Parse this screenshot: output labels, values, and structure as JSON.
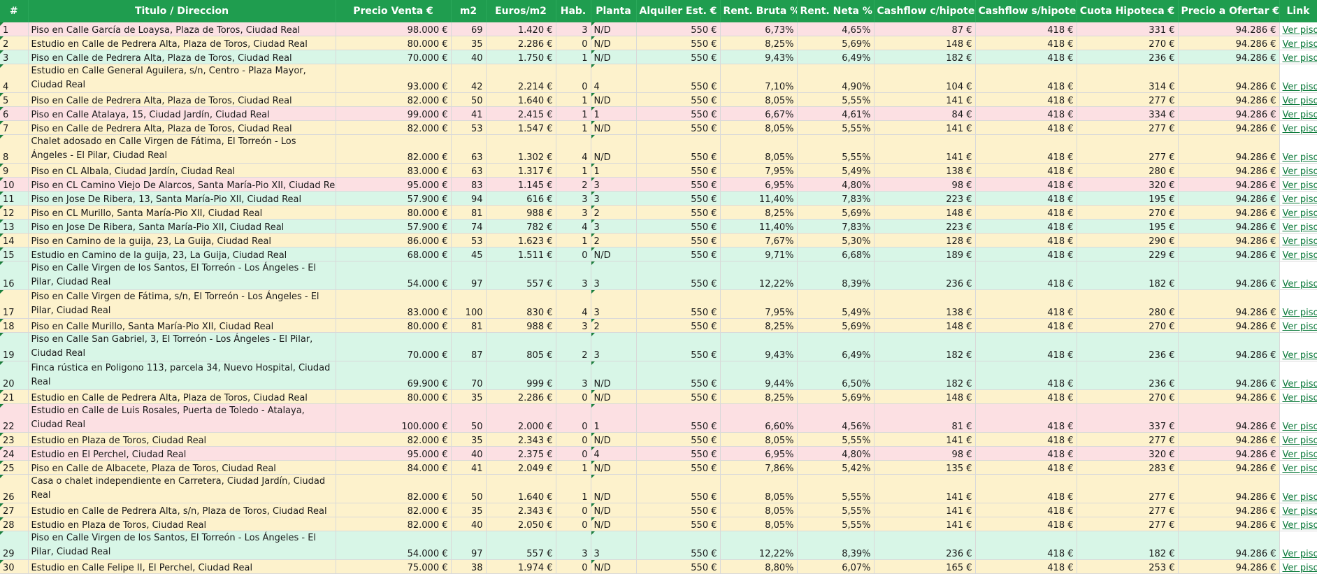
{
  "headers": [
    "#",
    "Titulo / Direccion",
    "Precio Venta €",
    "m2",
    "Euros/m2",
    "Hab.",
    "Planta",
    "Alquiler Est. €",
    "Rent. Bruta %",
    "Rent. Neta %",
    "Cashflow c/hipoteca €",
    "Cashflow s/hipoteca €",
    "Cuota Hipoteca €",
    "Precio a Ofertar €",
    "Link"
  ],
  "colors": {
    "header": "#1f9d4f",
    "pink": "#fce0e3",
    "yellow": "#fdf2cc",
    "green": "#d8f6e7",
    "link": "#0b7a3a"
  },
  "rows": [
    {
      "n": "1",
      "title": "Piso en Calle García de Loaysa, Plaza de Toros, Ciudad Real",
      "price": "98.000 €",
      "m2": "69",
      "eurm2": "1.420 €",
      "hab": "3",
      "planta": "N/D",
      "alq": "550 €",
      "rb": "6,73%",
      "rn": "4,65%",
      "cfc": "87 €",
      "cfs": "418 €",
      "cuota": "331 €",
      "oferta": "94.286 €",
      "link": "Ver piso",
      "color": "pink",
      "h": 1
    },
    {
      "n": "2",
      "title": "Estudio en Calle de Pedrera Alta, Plaza de Toros, Ciudad Real",
      "price": "80.000 €",
      "m2": "35",
      "eurm2": "2.286 €",
      "hab": "0",
      "planta": "N/D",
      "alq": "550 €",
      "rb": "8,25%",
      "rn": "5,69%",
      "cfc": "148 €",
      "cfs": "418 €",
      "cuota": "270 €",
      "oferta": "94.286 €",
      "link": "Ver piso",
      "color": "yellow",
      "h": 1
    },
    {
      "n": "3",
      "title": "Piso en Calle de Pedrera Alta, Plaza de Toros, Ciudad Real",
      "price": "70.000 €",
      "m2": "40",
      "eurm2": "1.750 €",
      "hab": "1",
      "planta": "N/D",
      "alq": "550 €",
      "rb": "9,43%",
      "rn": "6,49%",
      "cfc": "182 €",
      "cfs": "418 €",
      "cuota": "236 €",
      "oferta": "94.286 €",
      "link": "Ver piso",
      "color": "green",
      "h": 1
    },
    {
      "n": "4",
      "title": "Estudio en Calle General Aguilera, s/n, Centro - Plaza Mayor, Ciudad Real",
      "price": "93.000 €",
      "m2": "42",
      "eurm2": "2.214 €",
      "hab": "0",
      "planta": "4",
      "alq": "550 €",
      "rb": "7,10%",
      "rn": "4,90%",
      "cfc": "104 €",
      "cfs": "418 €",
      "cuota": "314 €",
      "oferta": "94.286 €",
      "link": "Ver piso",
      "color": "yellow",
      "h": 2
    },
    {
      "n": "5",
      "title": "Piso en Calle de Pedrera Alta, Plaza de Toros, Ciudad Real",
      "price": "82.000 €",
      "m2": "50",
      "eurm2": "1.640 €",
      "hab": "1",
      "planta": "N/D",
      "alq": "550 €",
      "rb": "8,05%",
      "rn": "5,55%",
      "cfc": "141 €",
      "cfs": "418 €",
      "cuota": "277 €",
      "oferta": "94.286 €",
      "link": "Ver piso",
      "color": "yellow",
      "h": 1
    },
    {
      "n": "6",
      "title": "Piso en Calle Atalaya, 15, Ciudad Jardín, Ciudad Real",
      "price": "99.000 €",
      "m2": "41",
      "eurm2": "2.415 €",
      "hab": "1",
      "planta": "1",
      "alq": "550 €",
      "rb": "6,67%",
      "rn": "4,61%",
      "cfc": "84 €",
      "cfs": "418 €",
      "cuota": "334 €",
      "oferta": "94.286 €",
      "link": "Ver piso",
      "color": "pink",
      "h": 1
    },
    {
      "n": "7",
      "title": "Piso en Calle de Pedrera Alta, Plaza de Toros, Ciudad Real",
      "price": "82.000 €",
      "m2": "53",
      "eurm2": "1.547 €",
      "hab": "1",
      "planta": "N/D",
      "alq": "550 €",
      "rb": "8,05%",
      "rn": "5,55%",
      "cfc": "141 €",
      "cfs": "418 €",
      "cuota": "277 €",
      "oferta": "94.286 €",
      "link": "Ver piso",
      "color": "yellow",
      "h": 1
    },
    {
      "n": "8",
      "title": "Chalet adosado en Calle Virgen de Fátima, El Torreón - Los Ángeles - El Pilar, Ciudad Real",
      "price": "82.000 €",
      "m2": "63",
      "eurm2": "1.302 €",
      "hab": "4",
      "planta": "N/D",
      "alq": "550 €",
      "rb": "8,05%",
      "rn": "5,55%",
      "cfc": "141 €",
      "cfs": "418 €",
      "cuota": "277 €",
      "oferta": "94.286 €",
      "link": "Ver piso",
      "color": "yellow",
      "h": 2
    },
    {
      "n": "9",
      "title": "Piso en CL Albala, Ciudad Jardín, Ciudad Real",
      "price": "83.000 €",
      "m2": "63",
      "eurm2": "1.317 €",
      "hab": "1",
      "planta": "1",
      "alq": "550 €",
      "rb": "7,95%",
      "rn": "5,49%",
      "cfc": "138 €",
      "cfs": "418 €",
      "cuota": "280 €",
      "oferta": "94.286 €",
      "link": "Ver piso",
      "color": "yellow",
      "h": 1
    },
    {
      "n": "10",
      "title": "Piso en CL Camino Viejo De Alarcos, Santa María-Pio XII, Ciudad Real",
      "price": "95.000 €",
      "m2": "83",
      "eurm2": "1.145 €",
      "hab": "2",
      "planta": "3",
      "alq": "550 €",
      "rb": "6,95%",
      "rn": "4,80%",
      "cfc": "98 €",
      "cfs": "418 €",
      "cuota": "320 €",
      "oferta": "94.286 €",
      "link": "Ver piso",
      "color": "pink",
      "h": 1
    },
    {
      "n": "11",
      "title": "Piso en Jose De Ribera, 13, Santa María-Pio XII, Ciudad Real",
      "price": "57.900 €",
      "m2": "94",
      "eurm2": "616 €",
      "hab": "3",
      "planta": "3",
      "alq": "550 €",
      "rb": "11,40%",
      "rn": "7,83%",
      "cfc": "223 €",
      "cfs": "418 €",
      "cuota": "195 €",
      "oferta": "94.286 €",
      "link": "Ver piso",
      "color": "green",
      "h": 1
    },
    {
      "n": "12",
      "title": "Piso en CL Murillo, Santa María-Pio XII, Ciudad Real",
      "price": "80.000 €",
      "m2": "81",
      "eurm2": "988 €",
      "hab": "3",
      "planta": "2",
      "alq": "550 €",
      "rb": "8,25%",
      "rn": "5,69%",
      "cfc": "148 €",
      "cfs": "418 €",
      "cuota": "270 €",
      "oferta": "94.286 €",
      "link": "Ver piso",
      "color": "yellow",
      "h": 1
    },
    {
      "n": "13",
      "title": "Piso en Jose De Ribera, Santa María-Pio XII, Ciudad Real",
      "price": "57.900 €",
      "m2": "74",
      "eurm2": "782 €",
      "hab": "4",
      "planta": "3",
      "alq": "550 €",
      "rb": "11,40%",
      "rn": "7,83%",
      "cfc": "223 €",
      "cfs": "418 €",
      "cuota": "195 €",
      "oferta": "94.286 €",
      "link": "Ver piso",
      "color": "green",
      "h": 1
    },
    {
      "n": "14",
      "title": "Piso en Camino de la guija, 23, La Guija, Ciudad Real",
      "price": "86.000 €",
      "m2": "53",
      "eurm2": "1.623 €",
      "hab": "1",
      "planta": "2",
      "alq": "550 €",
      "rb": "7,67%",
      "rn": "5,30%",
      "cfc": "128 €",
      "cfs": "418 €",
      "cuota": "290 €",
      "oferta": "94.286 €",
      "link": "Ver piso",
      "color": "yellow",
      "h": 1
    },
    {
      "n": "15",
      "title": "Estudio en Camino de la guija, 23, La Guija, Ciudad Real",
      "price": "68.000 €",
      "m2": "45",
      "eurm2": "1.511 €",
      "hab": "0",
      "planta": "N/D",
      "alq": "550 €",
      "rb": "9,71%",
      "rn": "6,68%",
      "cfc": "189 €",
      "cfs": "418 €",
      "cuota": "229 €",
      "oferta": "94.286 €",
      "link": "Ver piso",
      "color": "green",
      "h": 1
    },
    {
      "n": "16",
      "title": "Piso en Calle Virgen de los Santos, El Torreón - Los Ángeles - El Pilar, Ciudad Real",
      "price": "54.000 €",
      "m2": "97",
      "eurm2": "557 €",
      "hab": "3",
      "planta": "3",
      "alq": "550 €",
      "rb": "12,22%",
      "rn": "8,39%",
      "cfc": "236 €",
      "cfs": "418 €",
      "cuota": "182 €",
      "oferta": "94.286 €",
      "link": "Ver piso",
      "color": "green",
      "h": 2
    },
    {
      "n": "17",
      "title": "Piso en Calle Virgen de Fátima, s/n, El Torreón - Los Ángeles - El Pilar, Ciudad Real",
      "price": "83.000 €",
      "m2": "100",
      "eurm2": "830 €",
      "hab": "4",
      "planta": "3",
      "alq": "550 €",
      "rb": "7,95%",
      "rn": "5,49%",
      "cfc": "138 €",
      "cfs": "418 €",
      "cuota": "280 €",
      "oferta": "94.286 €",
      "link": "Ver piso",
      "color": "yellow",
      "h": 2
    },
    {
      "n": "18",
      "title": "Piso en Calle Murillo, Santa María-Pio XII, Ciudad Real",
      "price": "80.000 €",
      "m2": "81",
      "eurm2": "988 €",
      "hab": "3",
      "planta": "2",
      "alq": "550 €",
      "rb": "8,25%",
      "rn": "5,69%",
      "cfc": "148 €",
      "cfs": "418 €",
      "cuota": "270 €",
      "oferta": "94.286 €",
      "link": "Ver piso",
      "color": "yellow",
      "h": 1
    },
    {
      "n": "19",
      "title": "Piso en Calle San Gabriel, 3, El Torreón - Los Ángeles - El Pilar, Ciudad Real",
      "price": "70.000 €",
      "m2": "87",
      "eurm2": "805 €",
      "hab": "2",
      "planta": "3",
      "alq": "550 €",
      "rb": "9,43%",
      "rn": "6,49%",
      "cfc": "182 €",
      "cfs": "418 €",
      "cuota": "236 €",
      "oferta": "94.286 €",
      "link": "Ver piso",
      "color": "green",
      "h": 2
    },
    {
      "n": "20",
      "title": "Finca rústica en Poligono 113, parcela 34, Nuevo Hospital, Ciudad Real",
      "price": "69.900 €",
      "m2": "70",
      "eurm2": "999 €",
      "hab": "3",
      "planta": "N/D",
      "alq": "550 €",
      "rb": "9,44%",
      "rn": "6,50%",
      "cfc": "182 €",
      "cfs": "418 €",
      "cuota": "236 €",
      "oferta": "94.286 €",
      "link": "Ver piso",
      "color": "green",
      "h": 2
    },
    {
      "n": "21",
      "title": "Estudio en Calle de Pedrera Alta, Plaza de Toros, Ciudad Real",
      "price": "80.000 €",
      "m2": "35",
      "eurm2": "2.286 €",
      "hab": "0",
      "planta": "N/D",
      "alq": "550 €",
      "rb": "8,25%",
      "rn": "5,69%",
      "cfc": "148 €",
      "cfs": "418 €",
      "cuota": "270 €",
      "oferta": "94.286 €",
      "link": "Ver piso",
      "color": "yellow",
      "h": 1
    },
    {
      "n": "22",
      "title": "Estudio en Calle de Luis Rosales, Puerta de Toledo - Atalaya, Ciudad Real",
      "price": "100.000 €",
      "m2": "50",
      "eurm2": "2.000 €",
      "hab": "0",
      "planta": "1",
      "alq": "550 €",
      "rb": "6,60%",
      "rn": "4,56%",
      "cfc": "81 €",
      "cfs": "418 €",
      "cuota": "337 €",
      "oferta": "94.286 €",
      "link": "Ver piso",
      "color": "pink",
      "h": 2
    },
    {
      "n": "23",
      "title": "Estudio en Plaza de Toros, Ciudad Real",
      "price": "82.000 €",
      "m2": "35",
      "eurm2": "2.343 €",
      "hab": "0",
      "planta": "N/D",
      "alq": "550 €",
      "rb": "8,05%",
      "rn": "5,55%",
      "cfc": "141 €",
      "cfs": "418 €",
      "cuota": "277 €",
      "oferta": "94.286 €",
      "link": "Ver piso",
      "color": "yellow",
      "h": 1
    },
    {
      "n": "24",
      "title": "Estudio en El Perchel, Ciudad Real",
      "price": "95.000 €",
      "m2": "40",
      "eurm2": "2.375 €",
      "hab": "0",
      "planta": "4",
      "alq": "550 €",
      "rb": "6,95%",
      "rn": "4,80%",
      "cfc": "98 €",
      "cfs": "418 €",
      "cuota": "320 €",
      "oferta": "94.286 €",
      "link": "Ver piso",
      "color": "pink",
      "h": 1
    },
    {
      "n": "25",
      "title": "Piso en Calle de Albacete, Plaza de Toros, Ciudad Real",
      "price": "84.000 €",
      "m2": "41",
      "eurm2": "2.049 €",
      "hab": "1",
      "planta": "N/D",
      "alq": "550 €",
      "rb": "7,86%",
      "rn": "5,42%",
      "cfc": "135 €",
      "cfs": "418 €",
      "cuota": "283 €",
      "oferta": "94.286 €",
      "link": "Ver piso",
      "color": "yellow",
      "h": 1
    },
    {
      "n": "26",
      "title": "Casa o chalet independiente en Carretera, Ciudad Jardín, Ciudad Real",
      "price": "82.000 €",
      "m2": "50",
      "eurm2": "1.640 €",
      "hab": "1",
      "planta": "N/D",
      "alq": "550 €",
      "rb": "8,05%",
      "rn": "5,55%",
      "cfc": "141 €",
      "cfs": "418 €",
      "cuota": "277 €",
      "oferta": "94.286 €",
      "link": "Ver piso",
      "color": "yellow",
      "h": 2
    },
    {
      "n": "27",
      "title": "Estudio en Calle de Pedrera Alta, s/n, Plaza de Toros, Ciudad Real",
      "price": "82.000 €",
      "m2": "35",
      "eurm2": "2.343 €",
      "hab": "0",
      "planta": "N/D",
      "alq": "550 €",
      "rb": "8,05%",
      "rn": "5,55%",
      "cfc": "141 €",
      "cfs": "418 €",
      "cuota": "277 €",
      "oferta": "94.286 €",
      "link": "Ver piso",
      "color": "yellow",
      "h": 1
    },
    {
      "n": "28",
      "title": "Estudio en Plaza de Toros, Ciudad Real",
      "price": "82.000 €",
      "m2": "40",
      "eurm2": "2.050 €",
      "hab": "0",
      "planta": "N/D",
      "alq": "550 €",
      "rb": "8,05%",
      "rn": "5,55%",
      "cfc": "141 €",
      "cfs": "418 €",
      "cuota": "277 €",
      "oferta": "94.286 €",
      "link": "Ver piso",
      "color": "yellow",
      "h": 1
    },
    {
      "n": "29",
      "title": "Piso en Calle Virgen de los Santos, El Torreón - Los Ángeles - El Pilar, Ciudad Real",
      "price": "54.000 €",
      "m2": "97",
      "eurm2": "557 €",
      "hab": "3",
      "planta": "3",
      "alq": "550 €",
      "rb": "12,22%",
      "rn": "8,39%",
      "cfc": "236 €",
      "cfs": "418 €",
      "cuota": "182 €",
      "oferta": "94.286 €",
      "link": "Ver piso",
      "color": "green",
      "h": 2
    },
    {
      "n": "30",
      "title": "Estudio en Calle Felipe II, El Perchel, Ciudad Real",
      "price": "75.000 €",
      "m2": "38",
      "eurm2": "1.974 €",
      "hab": "0",
      "planta": "N/D",
      "alq": "550 €",
      "rb": "8,80%",
      "rn": "6,07%",
      "cfc": "165 €",
      "cfs": "418 €",
      "cuota": "253 €",
      "oferta": "94.286 €",
      "link": "Ver piso",
      "color": "yellow",
      "h": 1
    }
  ]
}
